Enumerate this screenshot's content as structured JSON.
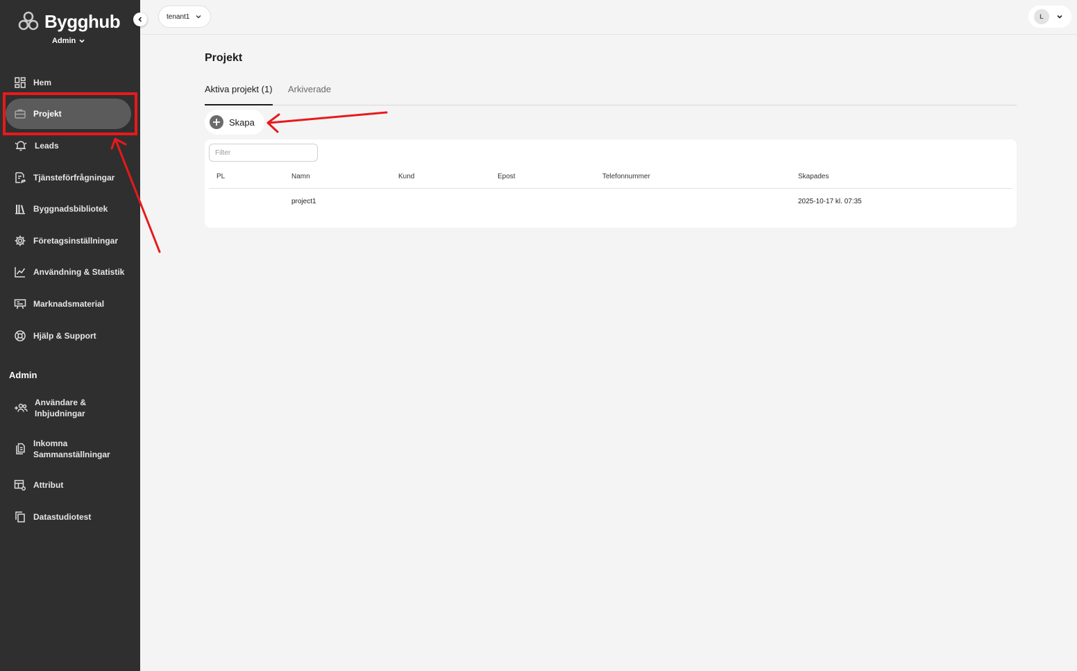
{
  "brand": {
    "name": "Bygghub",
    "role": "Admin"
  },
  "sidebar": {
    "items": [
      {
        "label": "Hem",
        "icon": "dashboard-icon"
      },
      {
        "label": "Projekt",
        "icon": "briefcase-icon"
      },
      {
        "label": "Leads",
        "icon": "bell-icon"
      },
      {
        "label": "Tjänsteförfrågningar",
        "icon": "document-edit-icon"
      },
      {
        "label": "Byggnadsbibliotek",
        "icon": "library-icon"
      },
      {
        "label": "Företagsinställningar",
        "icon": "gear-icon"
      },
      {
        "label": "Användning & Statistik",
        "icon": "chart-icon"
      },
      {
        "label": "Marknadsmaterial",
        "icon": "presentation-icon"
      },
      {
        "label": "Hjälp & Support",
        "icon": "lifebuoy-icon"
      }
    ],
    "admin_title": "Admin",
    "admin_items": [
      {
        "label_line1": "Användare &",
        "label_line2": "Inbjudningar",
        "icon": "add-users-icon"
      },
      {
        "label_line1": "Inkomna",
        "label_line2": "Sammanställningar",
        "icon": "documents-icon"
      },
      {
        "label": "Attribut",
        "icon": "table-settings-icon"
      },
      {
        "label": "Datastudiotest",
        "icon": "copy-icon"
      }
    ],
    "active_item": "Projekt"
  },
  "topbar": {
    "tenant": "tenant1",
    "user_initial": "L"
  },
  "main": {
    "title": "Projekt",
    "tabs": [
      {
        "label": "Aktiva projekt (1)",
        "active": true
      },
      {
        "label": "Arkiverade",
        "active": false
      }
    ],
    "create_label": "Skapa",
    "filter_placeholder": "Filter",
    "table": {
      "columns": [
        "PL",
        "Namn",
        "Kund",
        "Epost",
        "Telefonnummer",
        "Skapades"
      ],
      "rows": [
        {
          "pl": "",
          "namn": "project1",
          "kund": "",
          "epost": "",
          "telefon": "",
          "skapades": "2025-10-17 kl. 07:35"
        }
      ]
    }
  },
  "colors": {
    "sidebar_bg": "#2f2f2f",
    "active_bg": "#5b5b5b",
    "annotation_red": "#e8191b",
    "page_bg": "#f4f4f4"
  }
}
